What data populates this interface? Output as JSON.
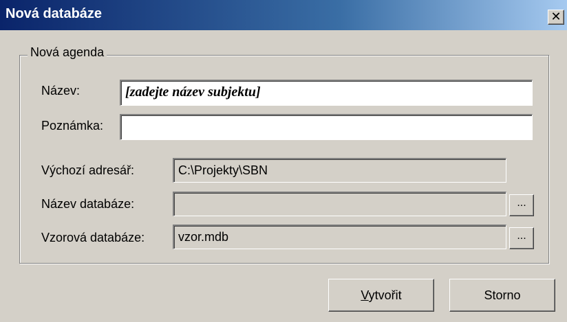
{
  "window": {
    "title": "Nová databáze",
    "close_glyph": "x"
  },
  "group": {
    "legend": "Nová agenda"
  },
  "form": {
    "name_label": "Název:",
    "name_value": "[zadejte název subjektu]",
    "note_label": "Poznámka:",
    "note_value": "",
    "default_dir_label": "Výchozí adresář:",
    "default_dir_value": "C:\\Projekty\\SBN",
    "db_name_label": "Název databáze:",
    "db_name_value": "",
    "template_db_label": "Vzorová databáze:",
    "template_db_value": "vzor.mdb",
    "browse_label": "..."
  },
  "buttons": {
    "create_mnemonic": "V",
    "create_rest": "ytvořit",
    "cancel": "Storno"
  }
}
